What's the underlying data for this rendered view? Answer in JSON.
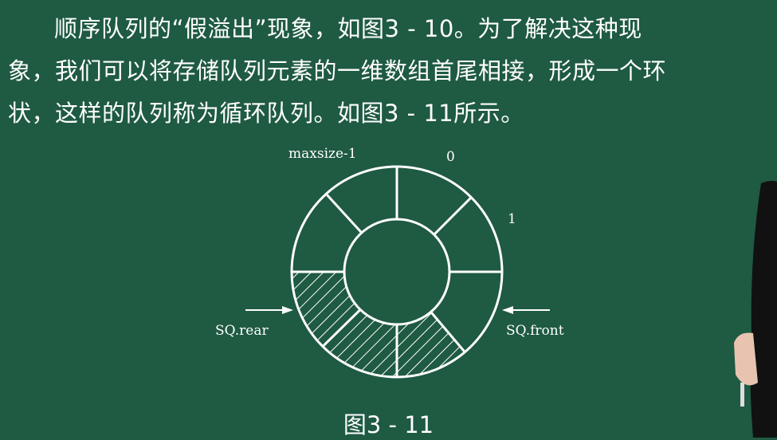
{
  "text": {
    "line1": "顺序队列的“假溢出”现象，如图3 - 10。为了解决这种现",
    "line2": "象，我们可以将存储队列元素的一维数组首尾相接，形成一个环",
    "line3": "状，这样的队列称为循环队列。如图3 - 11所示。"
  },
  "diagram": {
    "labels": {
      "maxsize": "maxsize-1",
      "zero": "0",
      "one": "1",
      "rear": "SQ.rear",
      "front": "SQ.front"
    },
    "segments": 8,
    "hatched_segments": 3
  },
  "caption": "图3 - 11",
  "colors": {
    "board": "#1f5a43",
    "chalk": "#ffffff"
  }
}
